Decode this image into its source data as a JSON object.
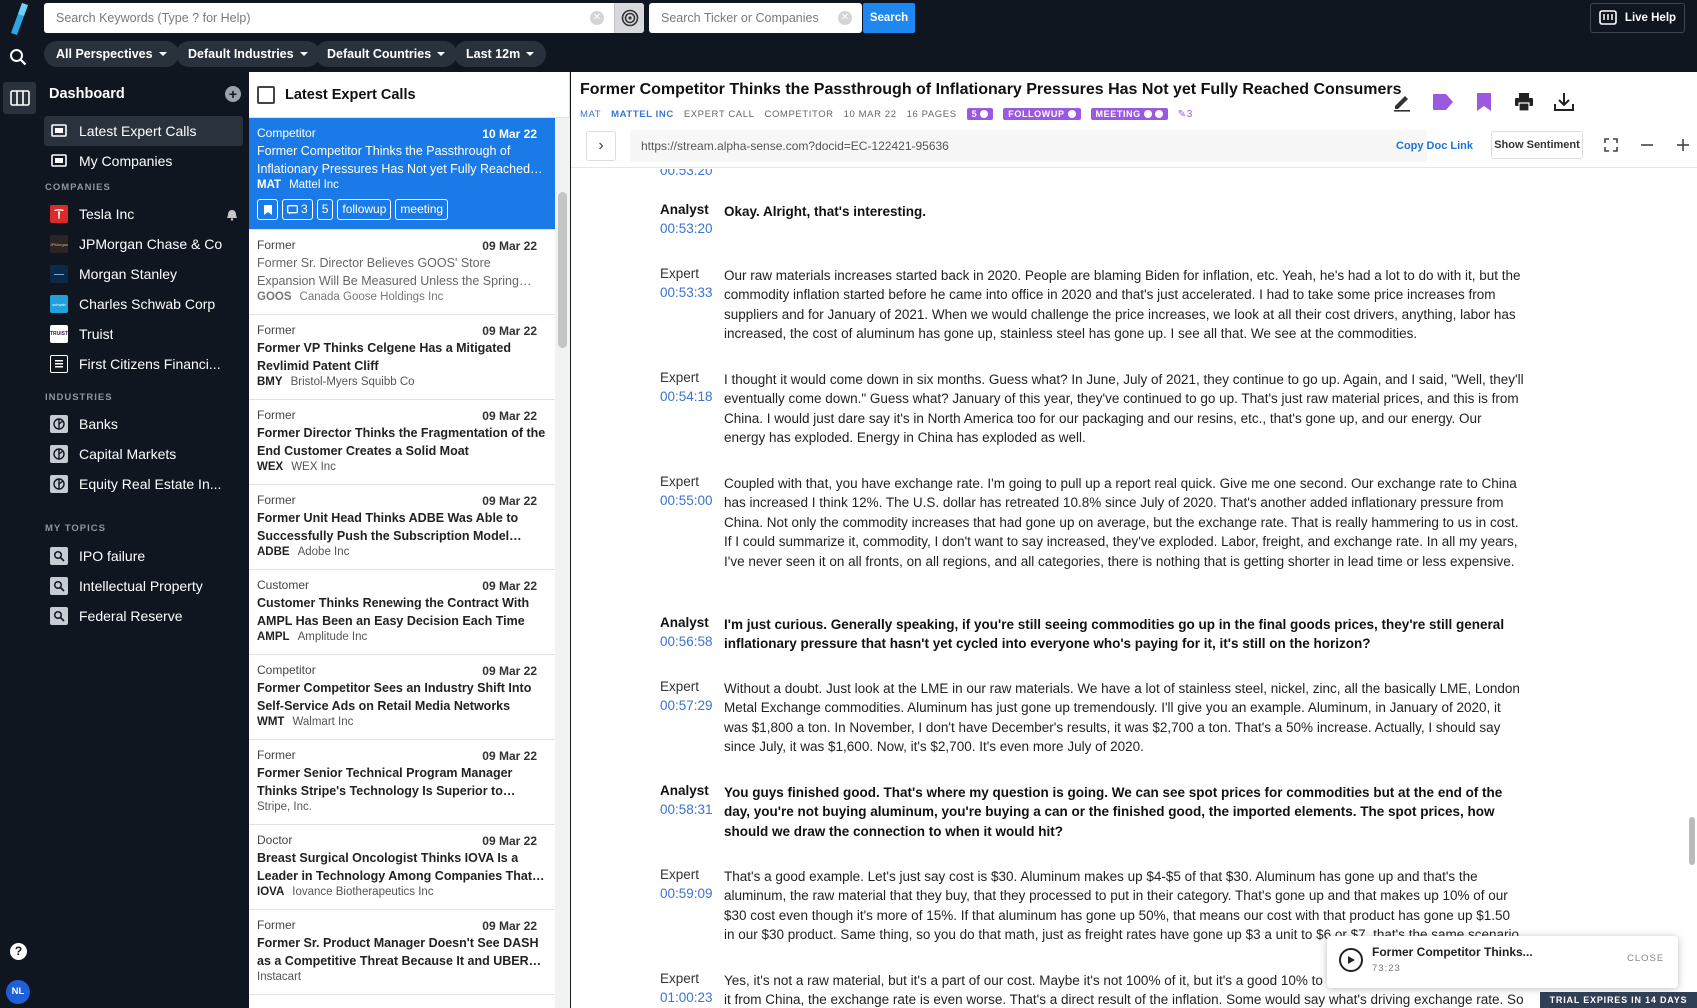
{
  "topbar": {
    "keyword_placeholder": "Search Keywords (Type ? for Help)",
    "ticker_placeholder": "Search Ticker or Companies",
    "search_label": "Search",
    "live_help_label": "Live Help",
    "filters": [
      "All Perspectives",
      "Default Industries",
      "Default Countries",
      "Last 12m"
    ]
  },
  "sidebar": {
    "title": "Dashboard",
    "main_items": [
      "Latest Expert Calls",
      "My Companies"
    ],
    "companies_label": "COMPANIES",
    "companies": [
      "Tesla Inc",
      "JPMorgan Chase & Co",
      "Morgan Stanley",
      "Charles Schwab Corp",
      "Truist",
      "First Citizens Financi..."
    ],
    "industries_label": "INDUSTRIES",
    "industries": [
      "Banks",
      "Capital Markets",
      "Equity Real Estate In..."
    ],
    "topics_label": "MY TOPICS",
    "topics": [
      "IPO failure",
      "Intellectual Property",
      "Federal Reserve"
    ],
    "avatar_initials": "NL"
  },
  "list": {
    "title": "Latest Expert Calls",
    "selected_tags": {
      "comments": "3",
      "count": "5",
      "tag1": "followup",
      "tag2": "meeting"
    },
    "cards": [
      {
        "type": "Competitor",
        "date": "10 Mar 22",
        "title": "Former Competitor Thinks the Passthrough of Inflationary Pressures Has Not yet Fully Reached Consumers",
        "ticker": "MAT",
        "company": "Mattel Inc"
      },
      {
        "type": "Former",
        "date": "09 Mar 22",
        "title": "Former Sr. Director Believes GOOS' Store Expansion Will Be Measured Unless the Spring Season Is Strong",
        "ticker": "GOOS",
        "company": "Canada Goose Holdings Inc"
      },
      {
        "type": "Former",
        "date": "09 Mar 22",
        "title": "Former VP Thinks Celgene Has a Mitigated Revlimid Patent Cliff",
        "ticker": "BMY",
        "company": "Bristol-Myers Squibb Co"
      },
      {
        "type": "Former",
        "date": "09 Mar 22",
        "title": "Former Director Thinks the Fragmentation of the End Customer Creates a Solid Moat",
        "ticker": "WEX",
        "company": "WEX Inc"
      },
      {
        "type": "Former",
        "date": "09 Mar 22",
        "title": "Former Unit Head Thinks ADBE Was Able to Successfully Push the Subscription Model Through",
        "ticker": "ADBE",
        "company": "Adobe Inc"
      },
      {
        "type": "Customer",
        "date": "09 Mar 22",
        "title": "Customer Thinks Renewing the Contract With AMPL Has Been an Easy Decision Each Time",
        "ticker": "AMPL",
        "company": "Amplitude Inc"
      },
      {
        "type": "Competitor",
        "date": "09 Mar 22",
        "title": "Former Competitor Sees an Industry Shift Into Self-Service Ads on Retail Media Networks",
        "ticker": "WMT",
        "company": "Walmart Inc"
      },
      {
        "type": "Former",
        "date": "09 Mar 22",
        "title": "Former Senior Technical Program Manager Thinks Stripe's Technology Is Superior to Legacy Players",
        "ticker": "",
        "company": "Stripe, Inc."
      },
      {
        "type": "Doctor",
        "date": "09 Mar 22",
        "title": "Breast Surgical Oncologist Thinks IOVA Is a Leader in Technology Among Companies That Focus on TIL",
        "ticker": "IOVA",
        "company": "Iovance Biotherapeutics Inc"
      },
      {
        "type": "Former",
        "date": "09 Mar 22",
        "title": "Former Sr. Product Manager Doesn't See DASH as a Competitive Threat Because It and UBER Are Different",
        "ticker": "",
        "company": "Instacart"
      }
    ]
  },
  "doc": {
    "title": "Former Competitor Thinks the Passthrough of Inflationary Pressures Has Not yet Fully Reached Consumers",
    "meta_ticker": "MAT",
    "meta_company": "MATTEL INC",
    "meta_type": "EXPERT CALL",
    "meta_perspective": "COMPETITOR",
    "meta_date": "10 MAR 22",
    "meta_pages": "16 PAGES",
    "meta_count_tag": "5",
    "meta_tag1": "FOLLOWUP",
    "meta_tag2": "MEETING",
    "meta_edits": "3",
    "url": "https://stream.alpha-sense.com?docid=EC-122421-95636",
    "copy_link_label": "Copy Doc Link",
    "sentiment_label": "Show Sentiment",
    "accent": "#9b59e0"
  },
  "transcript": {
    "leading_ts": "00:53:20",
    "entries": [
      {
        "speaker": "Analyst",
        "ts": "00:53:20",
        "text": "Okay. Alright, that's interesting."
      },
      {
        "speaker": "Expert",
        "ts": "00:53:33",
        "text": "Our raw materials increases started back in 2020. People are blaming Biden for inflation, etc. Yeah, he's had a lot to do with it, but the commodity inflation started before he came into office in 2020 and that's just accelerated. I had to take some price increases from suppliers and for January of 2021. When we would challenge the price increases, we look at all their cost drivers, anything, labor has increased, the cost of aluminum has gone up, stainless steel has gone up. I see all that. We see at the commodities."
      },
      {
        "speaker": "Expert",
        "ts": "00:54:18",
        "text": "I thought it would come down in six months. Guess what? In June, July of 2021, they continue to go up. Again, and I said, \"Well, they'll eventually come down.\" Guess what? January of this year, they've continued to go up. That's just raw material prices, and this is from China. I would just dare say it's in North America too for our packaging and our resins, etc., that's gone up, and our energy. Our energy has exploded. Energy in China has exploded as well."
      },
      {
        "speaker": "Expert",
        "ts": "00:55:00",
        "text": "Coupled with that, you have exchange rate. I'm going to pull up a report real quick. Give me one second. Our exchange rate to China has increased I think 12%. The U.S. dollar has retreated 10.8% since July of 2020. That's another added inflationary pressure from China. Not only the commodity increases that had gone up on average, but the exchange rate. That is really hammering to us in cost. If I could summarize it, commodity, I don't want to say increased, they've exploded. Labor, freight, and exchange rate. In all my years, I've never seen it on all fronts, on all regions, and all categories, there is nothing that is getting shorter in lead time or less expensive."
      },
      {
        "speaker": "Analyst",
        "ts": "00:56:58",
        "text": "I'm just curious. Generally speaking, if you're still seeing commodities go up in the final goods prices, they're still general inflationary pressure that hasn't yet cycled into everyone who's paying for it, it's still on the horizon?"
      },
      {
        "speaker": "Expert",
        "ts": "00:57:29",
        "text": "Without a doubt. Just look at the LME in our raw materials. We have a lot of stainless steel, nickel, zinc, all the basically LME, London Metal Exchange commodities. Aluminum has just gone up tremendously. I'll give you an example. Aluminum, in January of 2020, it was $1,800 a ton. In November, I don't have December's results, it was $2,700 a ton. That's a 50% increase. Actually, I should say since July, it was $1,600. Now, it's $2,700. It's even more July of 2020."
      },
      {
        "speaker": "Analyst",
        "ts": "00:58:31",
        "text": "You guys finished good. That's where my question is going. We can see spot prices for commodities but at the end of the day, you're not buying aluminum, you're buying a can or the finished good, the imported elements. The spot prices, how should we draw the connection to when it would hit?"
      },
      {
        "speaker": "Expert",
        "ts": "00:59:09",
        "text": "That's a good example. Let's just say cost is $30. Aluminum makes up $4-$5 of that $30. Aluminum has gone up and that's the aluminum, the raw material that they buy, that they processed to put in their category. That's gone up and that makes up 10% of our $30 cost even though it's more of 15%. If that aluminum has gone up 50%, that means our cost with that product has gone up $1.50 in our $30 product. Same thing, so you do that math, just as freight rates have gone up $3 a unit to $6 or $7, that's the same scenario."
      },
      {
        "speaker": "Expert",
        "ts": "01:00:23",
        "text": "Yes, it's not a raw material, but it's a part of our cost. Maybe it's not 100% of it, but it's a good 10% to 15% of it. Then when you look at it from China, the exchange rate is even worse. That's a direct result of the inflation. Some would say what's driving exchange rate. So"
      }
    ]
  },
  "player": {
    "title": "Former Competitor Thinks...",
    "time": "73:23",
    "close_label": "CLOSE"
  },
  "trial_label": "TRIAL EXPIRES IN 14 DAYS"
}
